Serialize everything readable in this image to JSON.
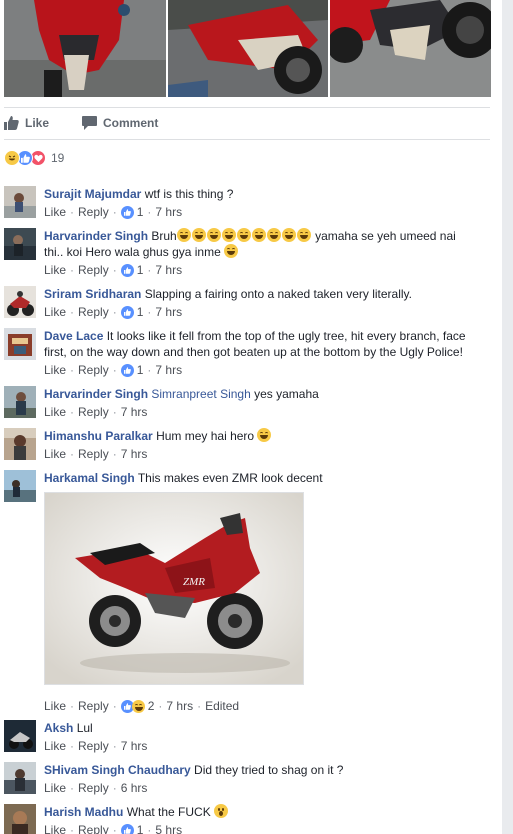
{
  "actions": {
    "like_label": "Like",
    "comment_label": "Comment"
  },
  "reactions": {
    "count": "19",
    "types": [
      "haha",
      "like",
      "love"
    ]
  },
  "colors": {
    "link": "#385898",
    "meta": "#90949c",
    "like_blue": "#5890ff",
    "love_red": "#f25268",
    "haha_yellow": "#f7c946"
  },
  "comments": [
    {
      "author": "Surajit Majumdar",
      "text": "wtf is this thing ?",
      "like": "Like",
      "reply": "Reply",
      "likes": "1",
      "time": "7 hrs"
    },
    {
      "author": "Harvarinder Singh",
      "text_start": "Bruh",
      "text_mid": " yamaha se yeh umeed nai",
      "text_line2": "thi.. koi Hero wala ghus gya inme",
      "like": "Like",
      "reply": "Reply",
      "likes": "1",
      "time": "7 hrs"
    },
    {
      "author": "Sriram Sridharan",
      "text": "Slapping a fairing onto a naked taken very literally.",
      "like": "Like",
      "reply": "Reply",
      "likes": "1",
      "time": "7 hrs"
    },
    {
      "author": "Dave Lace",
      "text_line1": "It looks like it fell from the top of the ugly tree, hit every branch, face",
      "text_line2": "first, on the way down and then got beaten up at the bottom by the Ugly Police!",
      "like": "Like",
      "reply": "Reply",
      "likes": "1",
      "time": "7 hrs"
    },
    {
      "author": "Harvarinder Singh",
      "mention": "Simranpreet Singh",
      "text": "yes yamaha",
      "like": "Like",
      "reply": "Reply",
      "time": "7 hrs"
    },
    {
      "author": "Himanshu Paralkar",
      "text": "Hum mey hai hero",
      "like": "Like",
      "reply": "Reply",
      "time": "7 hrs"
    },
    {
      "author": "Harkamal Singh",
      "text": "This makes even ZMR look decent",
      "like": "Like",
      "reply": "Reply",
      "likes": "2",
      "time": "7 hrs",
      "edited": "Edited"
    },
    {
      "author": "Aksh",
      "text": "Lul",
      "like": "Like",
      "reply": "Reply",
      "time": "7 hrs"
    },
    {
      "author": "SHivam Singh Chaudhary",
      "text": "Did they tried to shag on it ?",
      "like": "Like",
      "reply": "Reply",
      "time": "6 hrs"
    },
    {
      "author": "Harish Madhu",
      "text": "What the FUCK",
      "like": "Like",
      "reply": "Reply",
      "likes": "1",
      "time": "5 hrs"
    }
  ]
}
